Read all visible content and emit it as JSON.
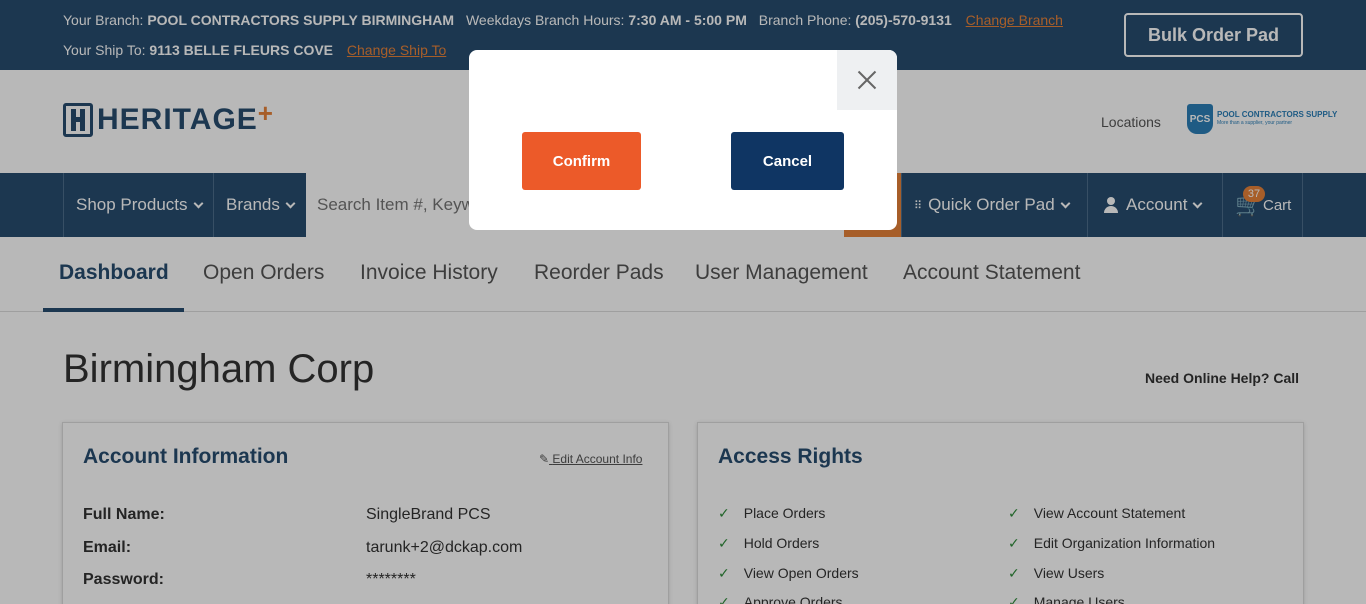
{
  "topbar": {
    "branch_label": "Your Branch:",
    "branch_name": "POOL CONTRACTORS SUPPLY BIRMINGHAM",
    "hours_label": "Weekdays Branch Hours:",
    "hours_value": "7:30 AM - 5:00 PM",
    "phone_label": "Branch Phone:",
    "phone_value": "(205)-570-9131",
    "change_branch": "Change Branch",
    "ship_label": "Your Ship To:",
    "ship_value": "9113 BELLE FLEURS COVE",
    "change_ship": "Change Ship To",
    "bulk_order": "Bulk Order Pad",
    "accent_color": "#e8833a",
    "bar_color": "#274d70"
  },
  "header": {
    "logo_text": "HERITAGE",
    "logo_plus": "+",
    "locations": "Locations",
    "partner_badge": "PCS",
    "partner_name": "POOL CONTRACTORS SUPPLY",
    "partner_tagline": "More than a supplier, your partner"
  },
  "nav": {
    "shop_products": "Shop Products",
    "brands": "Brands",
    "search_placeholder": "Search Item #, Keyword, Brand",
    "quick_order": "Quick Order Pad",
    "account": "Account",
    "cart": "Cart",
    "cart_count": "37"
  },
  "tabs": [
    {
      "label": "Dashboard",
      "active": true
    },
    {
      "label": "Open Orders"
    },
    {
      "label": "Invoice History"
    },
    {
      "label": "Reorder Pads"
    },
    {
      "label": "User Management"
    },
    {
      "label": "Account Statement"
    }
  ],
  "main": {
    "title": "Birmingham Corp",
    "help_text": "Need Online Help? Call"
  },
  "account_info": {
    "title": "Account Information",
    "edit_link": "Edit Account Info",
    "fields": [
      {
        "label": "Full Name:",
        "value": "SingleBrand PCS"
      },
      {
        "label": "Email:",
        "value": "tarunk+2@dckap.com"
      },
      {
        "label": "Password:",
        "value": "********"
      }
    ]
  },
  "access_rights": {
    "title": "Access Rights",
    "left": [
      "Place Orders",
      "Hold Orders",
      "View Open Orders",
      "Approve Orders"
    ],
    "right": [
      "View Account Statement",
      "Edit Organization Information",
      "View Users",
      "Manage Users"
    ]
  },
  "modal": {
    "confirm": "Confirm",
    "cancel": "Cancel",
    "confirm_color": "#ec5a29",
    "cancel_color": "#0f3563"
  }
}
